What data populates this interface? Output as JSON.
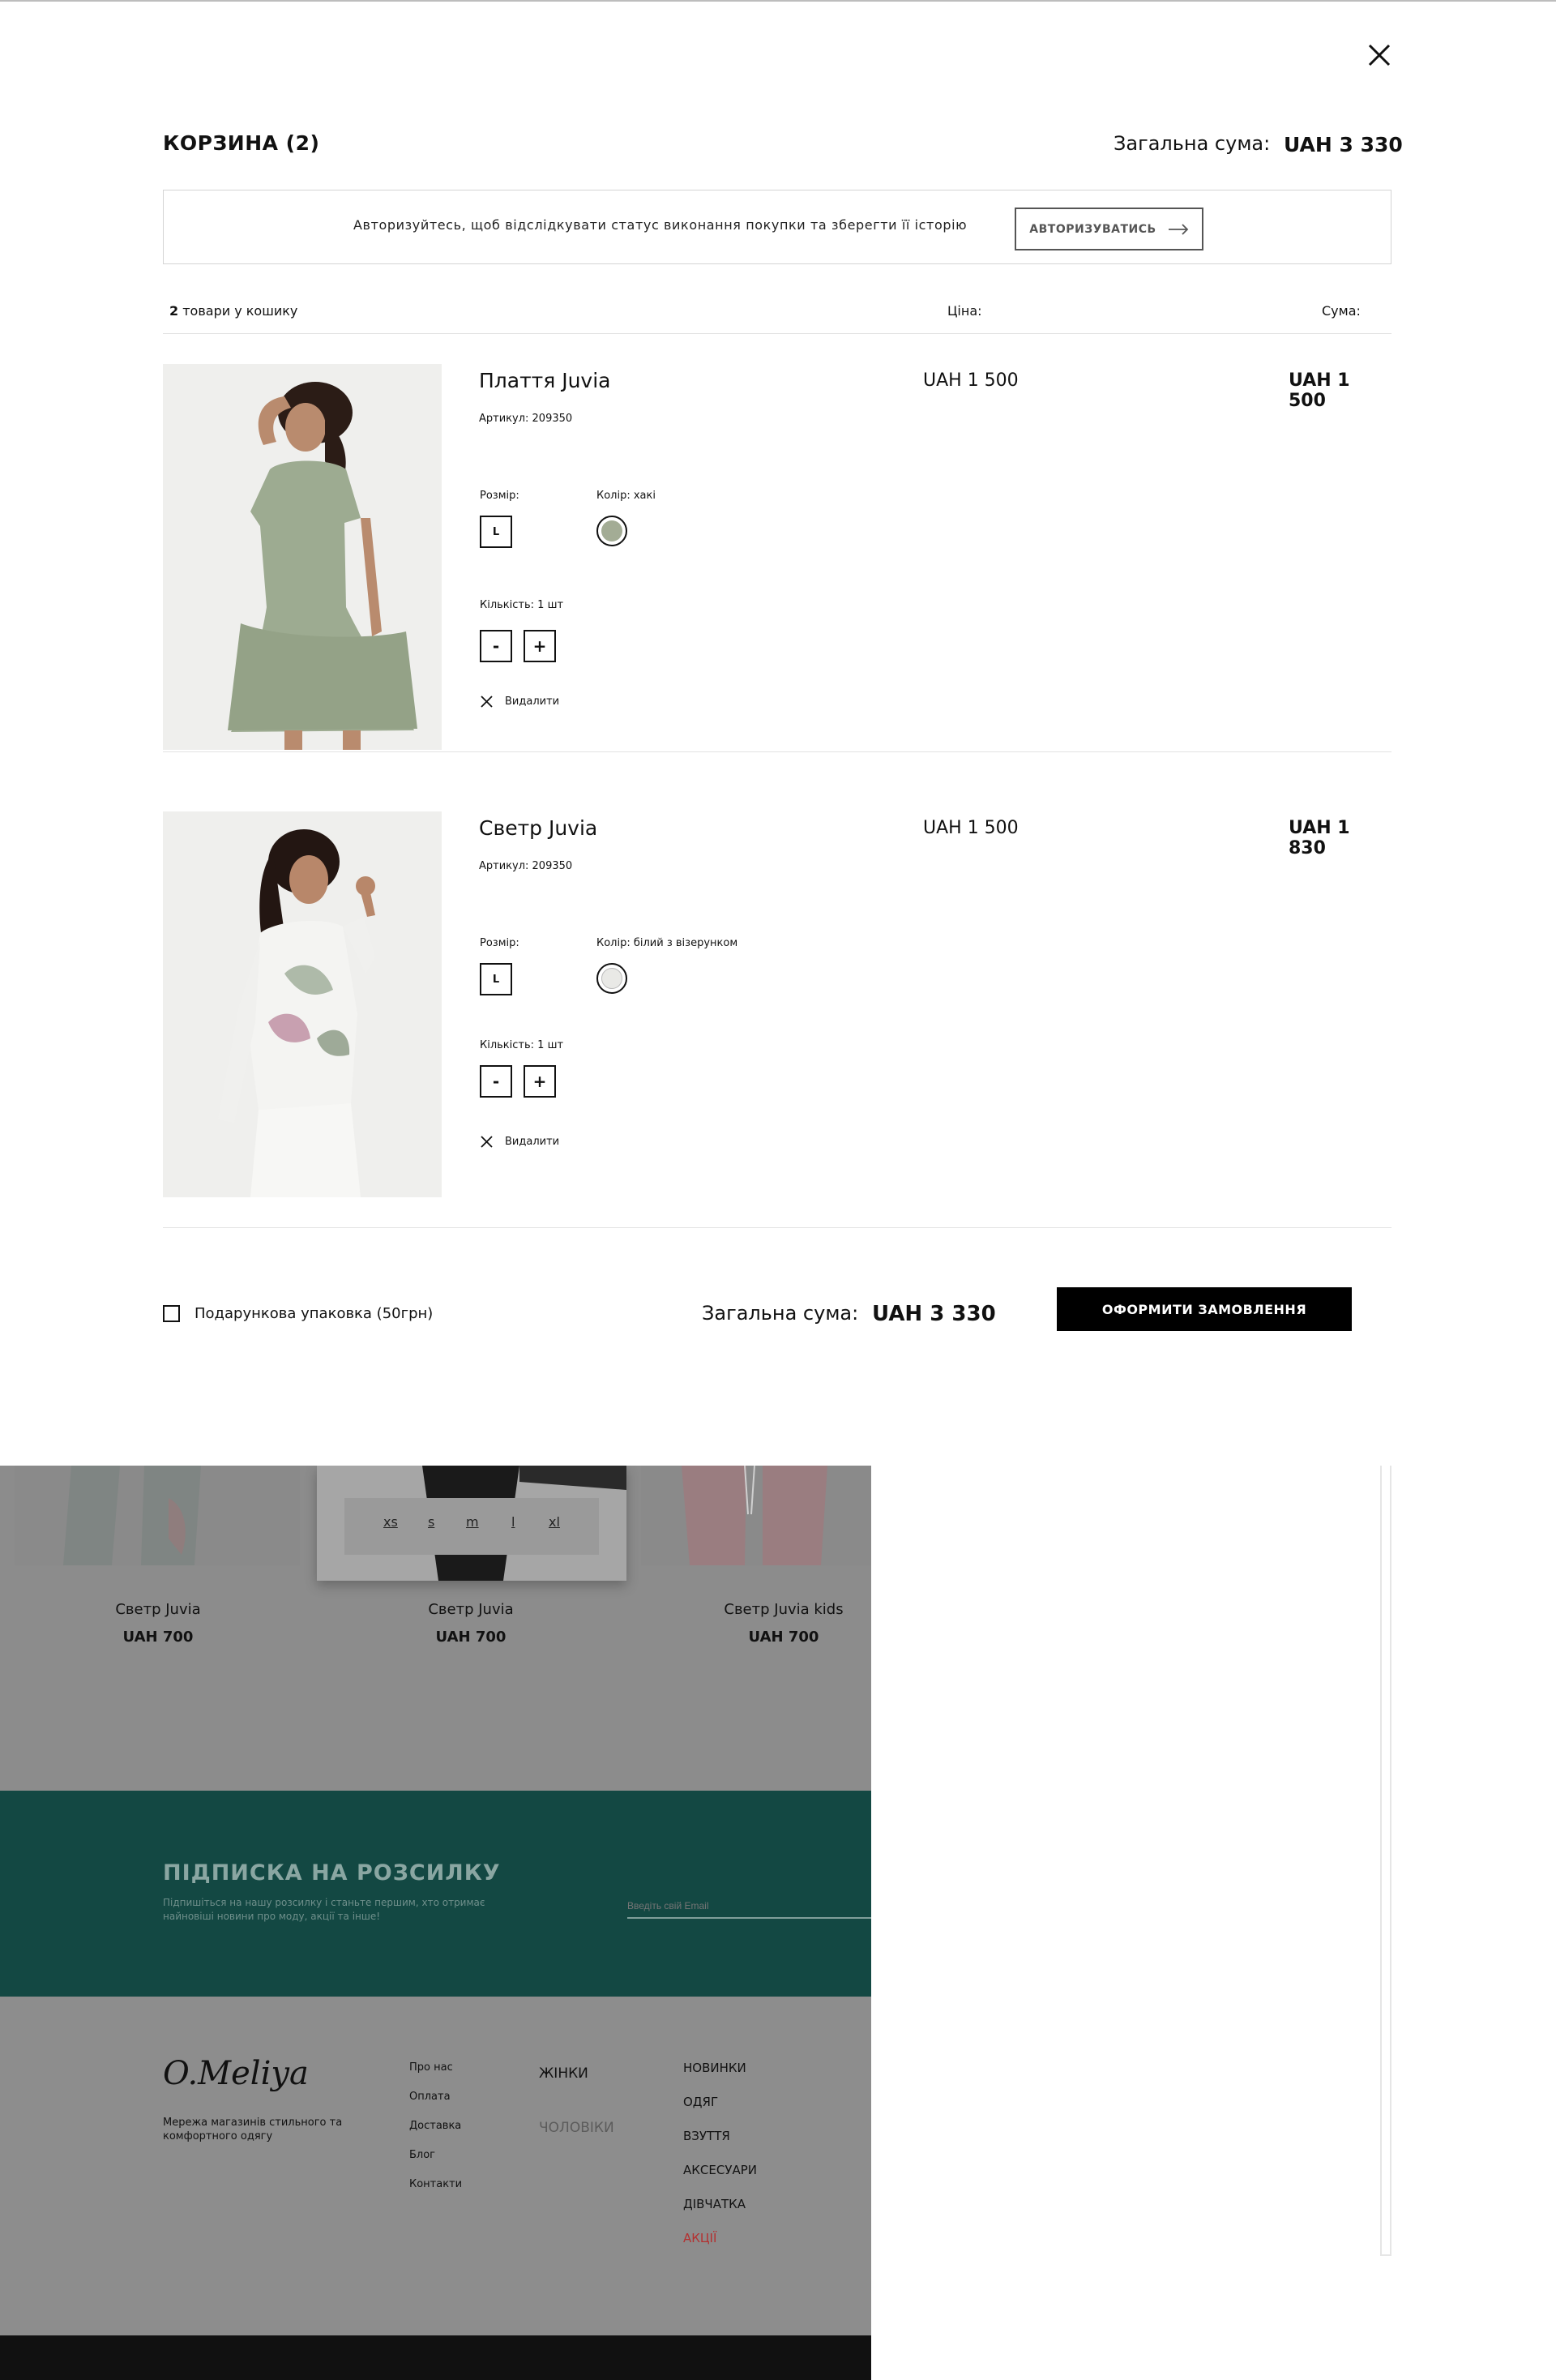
{
  "cart": {
    "title": "КОРЗИНА (2)",
    "total_label": "Загальна сума:",
    "total_value": "UAH  3 330",
    "auth_text": "Авторизуйтесь, щоб відслідкувати статус виконання покупки та зберегти її історію",
    "auth_button": "АВТОРИЗУВАТИСЬ",
    "header": {
      "count_number": "2",
      "count_text": " товари у кошику",
      "price_col": "Ціна:",
      "sum_col": "Сума:"
    },
    "items": [
      {
        "name": "Плаття Juvia",
        "article": "Артикул: 209350",
        "price": "UAH  1 500",
        "sum": "UAH  1 500",
        "size_label": "Розмір:",
        "size": "L",
        "color_label": "Колір: хакі",
        "color_hex": "#a3ac95",
        "qty_label": "Кількість: 1 шт",
        "minus": "-",
        "plus": "+",
        "remove": "Видалити"
      },
      {
        "name": "Светр Juvia",
        "article": "Артикул: 209350",
        "price": "UAH  1 500",
        "sum": "UAH  1 830",
        "size_label": "Розмір:",
        "size": "L",
        "color_label": "Колір: білий з візерунком",
        "color_hex": "#e9e9e6",
        "qty_label": "Кількість: 1 шт",
        "minus": "-",
        "plus": "+",
        "remove": "Видалити"
      }
    ],
    "gift_label": "Подарункова упаковка (50грн)",
    "checkout_button": "ОФОРМИТИ ЗАМОВЛЕННЯ"
  },
  "background_page": {
    "size_options": [
      "xs",
      "s",
      "m",
      "l",
      "xl"
    ],
    "products": [
      {
        "name": "Светр Juvia",
        "price": "UAH  700"
      },
      {
        "name": "Светр Juvia",
        "price": "UAH  700"
      },
      {
        "name": "Светр Juvia kids",
        "price": "UAH  700"
      }
    ],
    "subscribe": {
      "title": "ПІДПИСКА НА РОЗСИЛКУ",
      "description": "Підпишіться на нашу розсилку і станьте першим, хто отримає найновіші новини про моду, акції та інше!",
      "email_placeholder": "Введіть свій Email"
    },
    "footer": {
      "logo": "O.Meliya",
      "tagline": "Мережа магазинів стильного та комфортного одягу",
      "links": [
        "Про нас",
        "Оплата",
        "Доставка",
        "Блог",
        "Контакти"
      ],
      "categories": [
        "ЖІНКИ",
        "ЧОЛОВІКИ"
      ],
      "nav": [
        "НОВИНКИ",
        "ОДЯГ",
        "ВЗУТТЯ",
        "АКСЕСУАРИ",
        "ДІВЧАТКА",
        "АКЦІЇ"
      ]
    }
  },
  "colors": {
    "subscribe_bg": "#134843",
    "sale_red": "#b43030",
    "checkout_bg": "#000000"
  }
}
